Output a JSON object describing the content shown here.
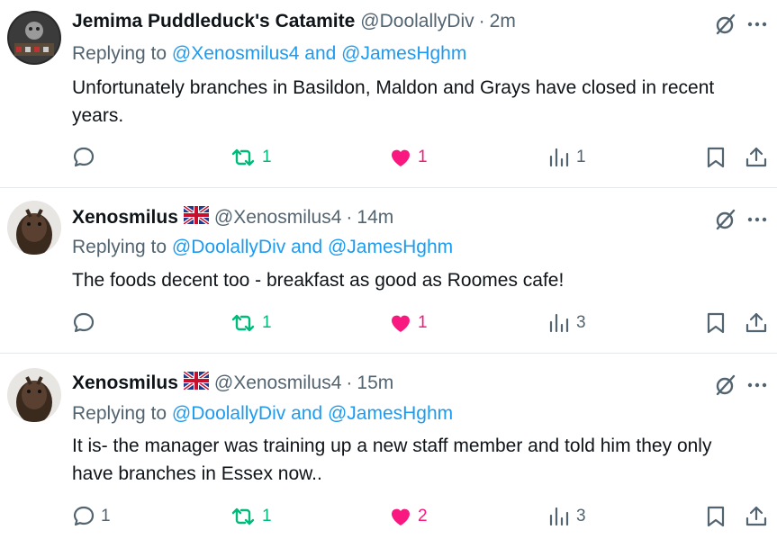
{
  "tweets": [
    {
      "author": "Jemima Puddleduck's Catamite",
      "handle": "@DoolallyDiv",
      "time": "2m",
      "replying_prefix": "Replying to",
      "replying_to": "@Xenosmilus4 and @JamesHghm",
      "text": "Unfortunately branches in Basildon, Maldon and Grays have closed in recent years.",
      "replies": "",
      "reposts": "1",
      "likes": "1",
      "views": "1",
      "has_flag": false
    },
    {
      "author": "Xenosmilus",
      "handle": "@Xenosmilus4",
      "time": "14m",
      "replying_prefix": "Replying to",
      "replying_to": "@DoolallyDiv and @JamesHghm",
      "text": "The foods decent too - breakfast as good as Roomes cafe!",
      "replies": "",
      "reposts": "1",
      "likes": "1",
      "views": "3",
      "has_flag": true
    },
    {
      "author": "Xenosmilus",
      "handle": "@Xenosmilus4",
      "time": "15m",
      "replying_prefix": "Replying to",
      "replying_to": "@DoolallyDiv and @JamesHghm",
      "text": "It is- the manager was training up a new staff member and told him they only have branches in Essex now..",
      "replies": "1",
      "reposts": "1",
      "likes": "2",
      "views": "3",
      "has_flag": true
    }
  ],
  "separator": "·",
  "icons": {
    "reply": "reply-icon",
    "repost": "repost-icon",
    "like": "heart-icon",
    "views": "views-icon",
    "bookmark": "bookmark-icon",
    "share": "share-icon",
    "grok": "grok-icon",
    "more": "more-icon",
    "flag": "uk-flag-icon"
  },
  "colors": {
    "text": "#0f1419",
    "secondary": "#536471",
    "link": "#1d9bf0",
    "repost": "#00ba7c",
    "like": "#f91880"
  }
}
